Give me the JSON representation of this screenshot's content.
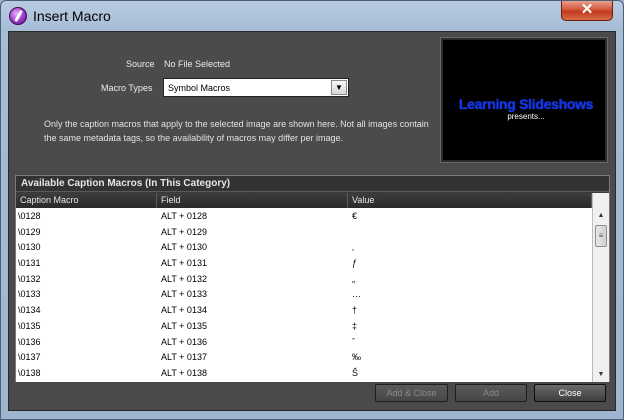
{
  "window": {
    "title": "Insert Macro",
    "close_glyph": "✕"
  },
  "source": {
    "label": "Source",
    "value": "No File Selected"
  },
  "macro_types": {
    "label": "Macro Types",
    "selected": "Symbol Macros"
  },
  "info_text": "Only the caption macros that apply to the selected image are shown here. Not all images contain the same metadata tags, so the availability of macros may differ per image.",
  "preview": {
    "title": "Learning Slideshows",
    "subtitle": "presents..."
  },
  "table": {
    "title": "Available Caption Macros (In This Category)",
    "columns": [
      "Caption Macro",
      "Field",
      "Value"
    ],
    "rows": [
      {
        "macro": "\\0128",
        "field": "ALT + 0128",
        "value": "€"
      },
      {
        "macro": "\\0129",
        "field": "ALT + 0129",
        "value": ""
      },
      {
        "macro": "\\0130",
        "field": "ALT + 0130",
        "value": "‚"
      },
      {
        "macro": "\\0131",
        "field": "ALT + 0131",
        "value": "ƒ"
      },
      {
        "macro": "\\0132",
        "field": "ALT + 0132",
        "value": "„"
      },
      {
        "macro": "\\0133",
        "field": "ALT + 0133",
        "value": "…"
      },
      {
        "macro": "\\0134",
        "field": "ALT + 0134",
        "value": "†"
      },
      {
        "macro": "\\0135",
        "field": "ALT + 0135",
        "value": "‡"
      },
      {
        "macro": "\\0136",
        "field": "ALT + 0136",
        "value": "ˆ"
      },
      {
        "macro": "\\0137",
        "field": "ALT + 0137",
        "value": "‰"
      },
      {
        "macro": "\\0138",
        "field": "ALT + 0138",
        "value": "Š"
      }
    ]
  },
  "buttons": {
    "add_close": "Add & Close",
    "add": "Add",
    "close": "Close"
  },
  "colors": {
    "preview_title": "#1133ee",
    "panel_bg": "#4b4b4b"
  }
}
